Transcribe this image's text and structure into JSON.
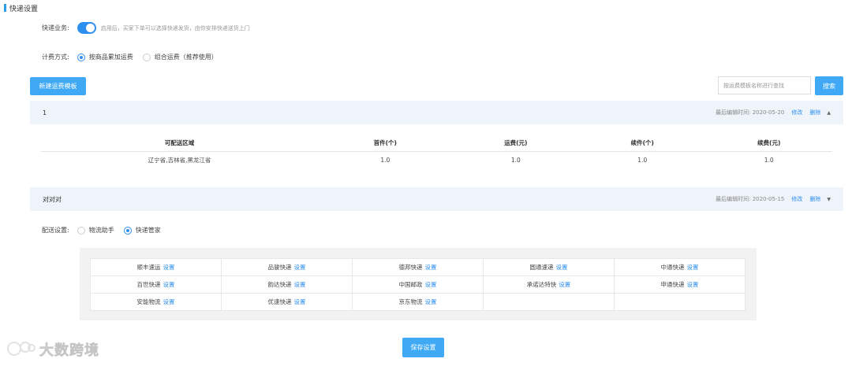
{
  "page": {
    "title": "快递设置"
  },
  "express_service": {
    "label": "快递业务:",
    "enabled": true,
    "hint": "启用后，买家下单可以选择快递发货，由你安排快递送货上门"
  },
  "billing": {
    "label": "计费方式:",
    "options": [
      {
        "label": "按商品累加运费",
        "selected": true
      },
      {
        "label": "组合运费（推荐使用）",
        "selected": false
      }
    ]
  },
  "toolbar": {
    "new_template_label": "新建运费模板",
    "search_placeholder": "按运费模板名称进行查找",
    "search_label": "搜索"
  },
  "templates": [
    {
      "name": "1",
      "edited": "最后编辑时间: 2020-05-20",
      "edit_label": "修改",
      "delete_label": "删除",
      "expanded": true,
      "columns": [
        "可配送区域",
        "首件(个)",
        "运费(元)",
        "续件(个)",
        "续费(元)"
      ],
      "rows": [
        [
          "辽宁省,吉林省,黑龙江省",
          "1.0",
          "1.0",
          "1.0",
          "1.0"
        ]
      ]
    },
    {
      "name": "对对对",
      "edited": "最后编辑时间: 2020-05-15",
      "edit_label": "修改",
      "delete_label": "删除",
      "expanded": false
    }
  ],
  "delivery": {
    "label": "配送设置:",
    "options": [
      {
        "label": "物流助手",
        "selected": false
      },
      {
        "label": "快递管家",
        "selected": true
      }
    ]
  },
  "carriers": {
    "set_label": "设置",
    "rows": [
      [
        "顺丰速运",
        "品骏快递",
        "德邦快递",
        "圆通速递",
        "中通快递"
      ],
      [
        "百世快递",
        "韵达快递",
        "中国邮政",
        "承诺达特快",
        "申通快递"
      ],
      [
        "安能物流",
        "优速快递",
        "京东物流",
        "",
        ""
      ]
    ]
  },
  "save_label": "保存设置",
  "watermark": {
    "text": "大数跨境"
  },
  "colors": {
    "accent": "#2d8ff0",
    "button": "#3fa9f5",
    "header_bg": "#eef4fa"
  }
}
